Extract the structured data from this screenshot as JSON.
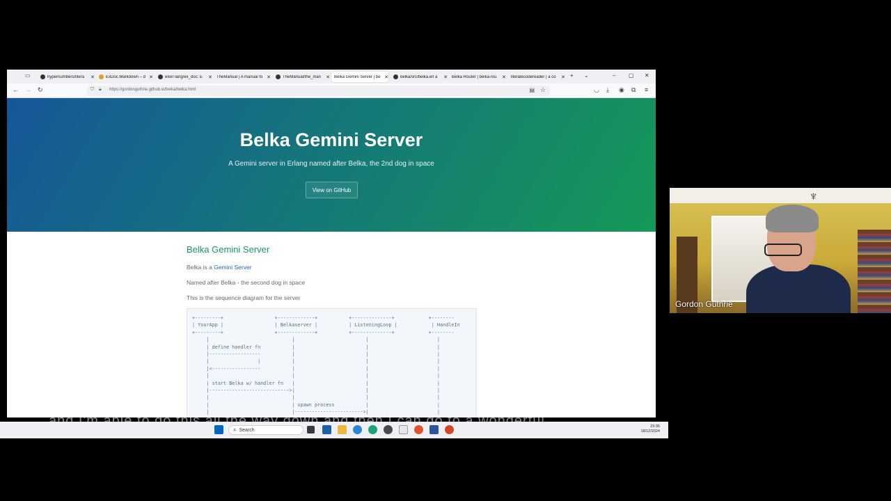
{
  "browser": {
    "tabs": [
      {
        "title": "hypernumbers/litera",
        "icon": "github"
      },
      {
        "title": "ExDoc.Markdown – d",
        "icon": "exdoc"
      },
      {
        "title": "elixir-lang/ex_doc: E",
        "icon": "github"
      },
      {
        "title": "TheManual | A manual fo",
        "icon": "none"
      },
      {
        "title": "TheManual/the_man",
        "icon": "github"
      },
      {
        "title": "Belka Gemini Server | be",
        "icon": "none",
        "active": true
      },
      {
        "title": "belka/src/belka.erl a",
        "icon": "github"
      },
      {
        "title": "Belka Router | belka-rou",
        "icon": "none"
      },
      {
        "title": "literatecodereader | a co",
        "icon": "none"
      }
    ],
    "url": "https://gordonguthrie.github.io/belka/belka.html"
  },
  "page": {
    "hero": {
      "title": "Belka Gemini Server",
      "tagline": "A Gemini server in Erlang named after Belka, the 2nd dog in space",
      "button": "View on GitHub"
    },
    "heading": "Belka Gemini Server",
    "para1_prefix": "Belka is a ",
    "para1_link": "Gemini Server",
    "para2": "Named after Belka - the second dog in space",
    "para3": "This is the sequence diagram for the server",
    "code": "+---------+                  +-------------+           +--------------+            +--------\n| YourApp |                  | Belkaserver |           | ListeningLoop |            | HandleIn\n+---------+                  +-------------+           +--------------+            +--------\n     |                             |                         |                        |\n     | define handler fn           |                         |                        |\n     |------------------           |                         |                        |\n     |                 |           |                         |                        |\n     |<-----------------           |                         |                        |\n     |                             |                         |                        |\n     | start Belka w/ handler fn   |                         |                        |\n     |---------------------------->|                         |                        |\n     |                             |                         |                        |\n     |                             | spawn process           |                        |\n     |                             |------------------------>|                        |"
  },
  "caption": "and I'm able to do this all the way down and then I can go to a wonderful",
  "taskbar": {
    "search_placeholder": "Search",
    "time": "23:35",
    "date": "18/12/2024"
  },
  "webcam": {
    "name": "Gordon Guthrie"
  }
}
